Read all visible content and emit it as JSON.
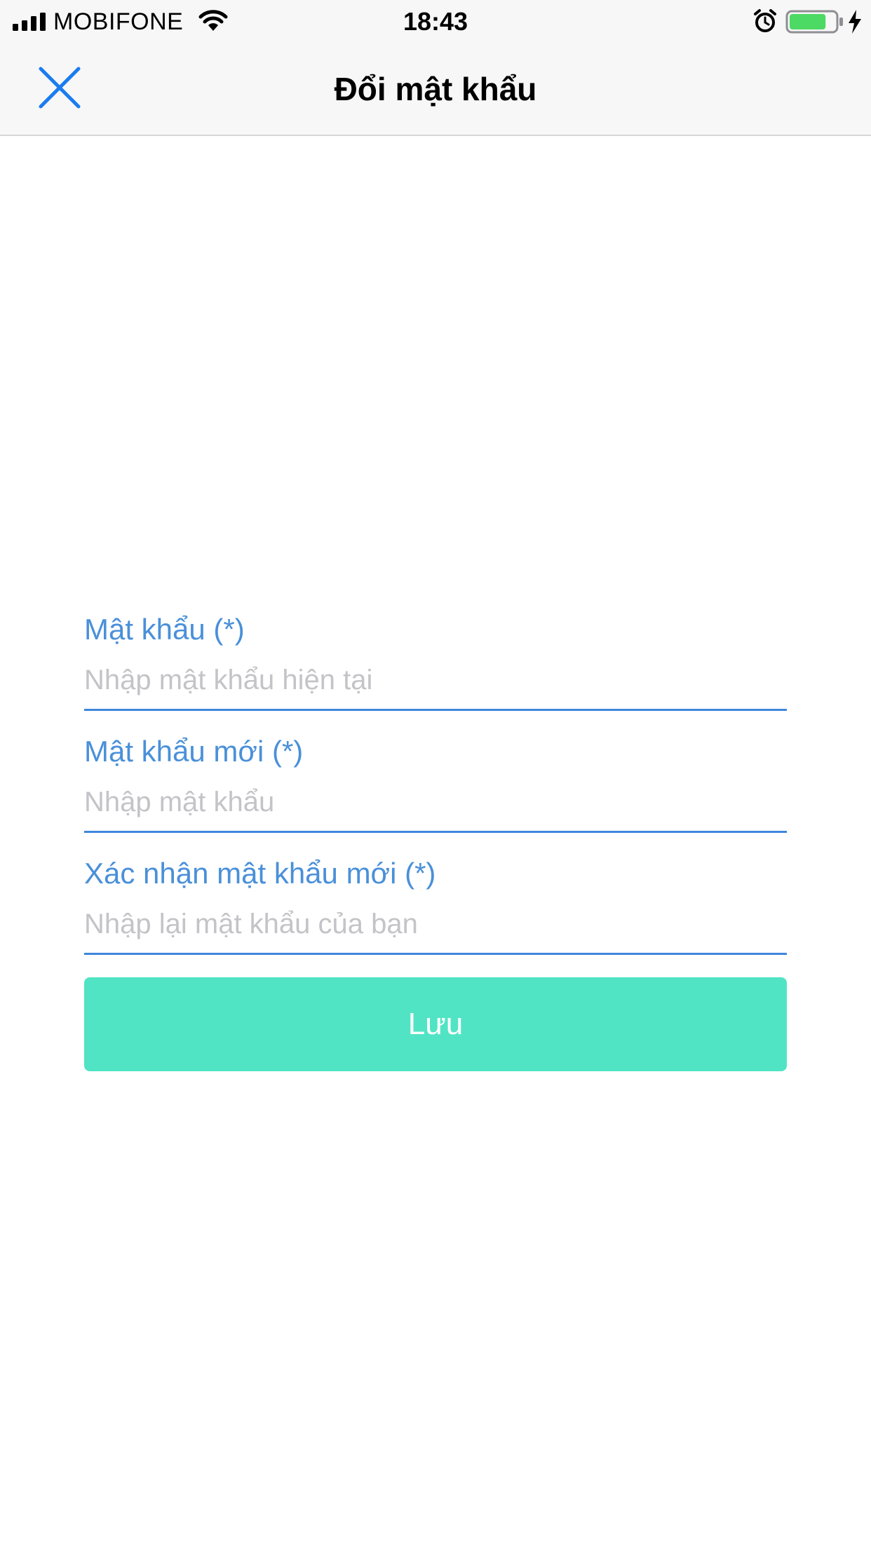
{
  "status_bar": {
    "carrier": "MOBIFONE",
    "time": "18:43",
    "icons": [
      "signal-icon",
      "wifi-icon",
      "alarm-icon",
      "battery-icon",
      "charging-bolt-icon"
    ],
    "battery_level": 0.8,
    "battery_color": "#4cd964"
  },
  "nav": {
    "title": "Đổi mật khẩu",
    "close_icon": "close-icon",
    "accent": "#1a7cf0"
  },
  "form": {
    "fields": [
      {
        "label": "Mật khẩu (*)",
        "placeholder": "Nhập mật khẩu hiện tại"
      },
      {
        "label": "Mật khẩu mới (*)",
        "placeholder": "Nhập mật khẩu"
      },
      {
        "label": "Xác nhận mật khẩu mới (*)",
        "placeholder": "Nhập lại mật khẩu của bạn"
      }
    ],
    "label_color": "#4a90d9",
    "save_label": "Lưu",
    "save_color": "#51e4c4"
  }
}
